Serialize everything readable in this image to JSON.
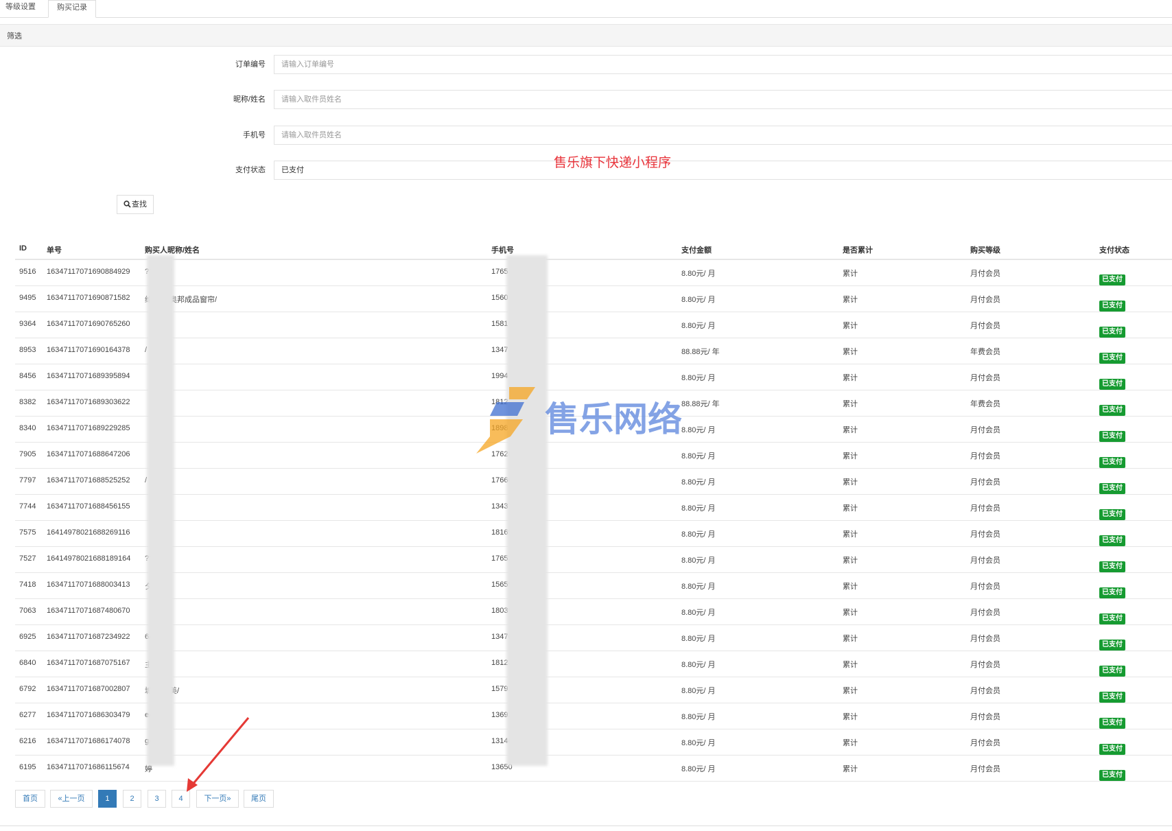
{
  "tabs": [
    {
      "label": "等级设置"
    },
    {
      "label": "购买记录"
    }
  ],
  "filter": {
    "title": "筛选",
    "order_no": {
      "label": "订单编号",
      "placeholder": "请输入订单编号"
    },
    "nickname": {
      "label": "昵称/姓名",
      "placeholder": "请输入取件员姓名"
    },
    "phone": {
      "label": "手机号",
      "placeholder": "请输入取件员姓名"
    },
    "pay_status": {
      "label": "支付状态",
      "value": "已支付"
    },
    "search_label": "查找",
    "promo_text": "售乐旗下快递小程序"
  },
  "table": {
    "columns": [
      "ID",
      "单号",
      "购买人昵称/姓名",
      "手机号",
      "支付金额",
      "是否累计",
      "购买等级",
      "支付状态"
    ],
    "rows": [
      {
        "id": "9516",
        "no": "16347117071690884929",
        "name": "??????/",
        "phone": "1765 09",
        "amount": "8.80元/ 月",
        "cum": "累计",
        "level": "月付会员",
        "status": "已支付"
      },
      {
        "id": "9495",
        "no": "16347117071690871582",
        "name": "纶墙布 奥邦成品窗帘/",
        "phone": "1560 16",
        "amount": "8.80元/ 月",
        "cum": "累计",
        "level": "月付会员",
        "status": "已支付"
      },
      {
        "id": "9364",
        "no": "16347117071690765260",
        "name": "",
        "phone": "1581 5",
        "amount": "8.80元/ 月",
        "cum": "累计",
        "level": "月付会员",
        "status": "已支付"
      },
      {
        "id": "8953",
        "no": "16347117071690164378",
        "name": "/",
        "phone": "1347",
        "amount": "88.88元/ 年",
        "cum": "累计",
        "level": "年费会员",
        "status": "已支付"
      },
      {
        "id": "8456",
        "no": "16347117071689395894",
        "name": "",
        "phone": "1994",
        "amount": "8.80元/ 月",
        "cum": "累计",
        "level": "月付会员",
        "status": "已支付"
      },
      {
        "id": "8382",
        "no": "16347117071689303622",
        "name": "",
        "phone": "1812",
        "amount": "88.88元/ 年",
        "cum": "累计",
        "level": "年费会员",
        "status": "已支付"
      },
      {
        "id": "8340",
        "no": "16347117071689229285",
        "name": "",
        "phone": "1898 2",
        "amount": "8.80元/ 月",
        "cum": "累计",
        "level": "月付会员",
        "status": "已支付"
      },
      {
        "id": "7905",
        "no": "16347117071688647206",
        "name": "",
        "phone": "176282 4",
        "amount": "8.80元/ 月",
        "cum": "累计",
        "level": "月付会员",
        "status": "已支付"
      },
      {
        "id": "7797",
        "no": "16347117071688525252",
        "name": "/",
        "phone": "176607",
        "amount": "8.80元/ 月",
        "cum": "累计",
        "level": "月付会员",
        "status": "已支付"
      },
      {
        "id": "7744",
        "no": "16347117071688456155",
        "name": "",
        "phone": "13437",
        "amount": "8.80元/ 月",
        "cum": "累计",
        "level": "月付会员",
        "status": "已支付"
      },
      {
        "id": "7575",
        "no": "16414978021688269116",
        "name": "",
        "phone": "18169",
        "amount": "8.80元/ 月",
        "cum": "累计",
        "level": "月付会员",
        "status": "已支付"
      },
      {
        "id": "7527",
        "no": "16414978021688189164",
        "name": "??   ???/",
        "phone": "17653",
        "amount": "8.80元/ 月",
        "cum": "累计",
        "level": "月付会员",
        "status": "已支付"
      },
      {
        "id": "7418",
        "no": "16347117071688003413",
        "name": "夕",
        "phone": "15659",
        "amount": "8.80元/ 月",
        "cum": "累计",
        "level": "月付会员",
        "status": "已支付"
      },
      {
        "id": "7063",
        "no": "16347117071687480670",
        "name": "",
        "phone": "18039",
        "amount": "8.80元/ 月",
        "cum": "累计",
        "level": "月付会员",
        "status": "已支付"
      },
      {
        "id": "6925",
        "no": "16347117071687234922",
        "name": "6/",
        "phone": "13476",
        "amount": "8.80元/ 月",
        "cum": "累计",
        "level": "月付会员",
        "status": "已支付"
      },
      {
        "id": "6840",
        "no": "16347117071687075167",
        "name": "主/",
        "phone": "18123",
        "amount": "8.80元/ 月",
        "cum": "累计",
        "level": "月付会员",
        "status": "已支付"
      },
      {
        "id": "6792",
        "no": "16347117071687002807",
        "name": "城北街   美/",
        "phone": "157912",
        "amount": "8.80元/ 月",
        "cum": "累计",
        "level": "月付会员",
        "status": "已支付"
      },
      {
        "id": "6277",
        "no": "16347117071686303479",
        "name": "e/",
        "phone": "136924",
        "amount": "8.80元/ 月",
        "cum": "累计",
        "level": "月付会员",
        "status": "已支付"
      },
      {
        "id": "6216",
        "no": "16347117071686174078",
        "name": "g/",
        "phone": "131461",
        "amount": "8.80元/ 月",
        "cum": "累计",
        "level": "月付会员",
        "status": "已支付"
      },
      {
        "id": "6195",
        "no": "16347117071686115674",
        "name": "婷",
        "phone": "13650",
        "amount": "8.80元/ 月",
        "cum": "累计",
        "level": "月付会员",
        "status": "已支付"
      }
    ]
  },
  "pagination": {
    "first": "首页",
    "prev": "«上一页",
    "pages": [
      "1",
      "2",
      "3",
      "4"
    ],
    "current": "1",
    "next": "下一页»",
    "last": "尾页"
  },
  "watermark": {
    "text": "售乐网络"
  },
  "colors": {
    "badge_green": "#169b31",
    "pager_blue": "#337ab7",
    "promo_red": "#e8343b",
    "arrow_red": "#e53935"
  }
}
